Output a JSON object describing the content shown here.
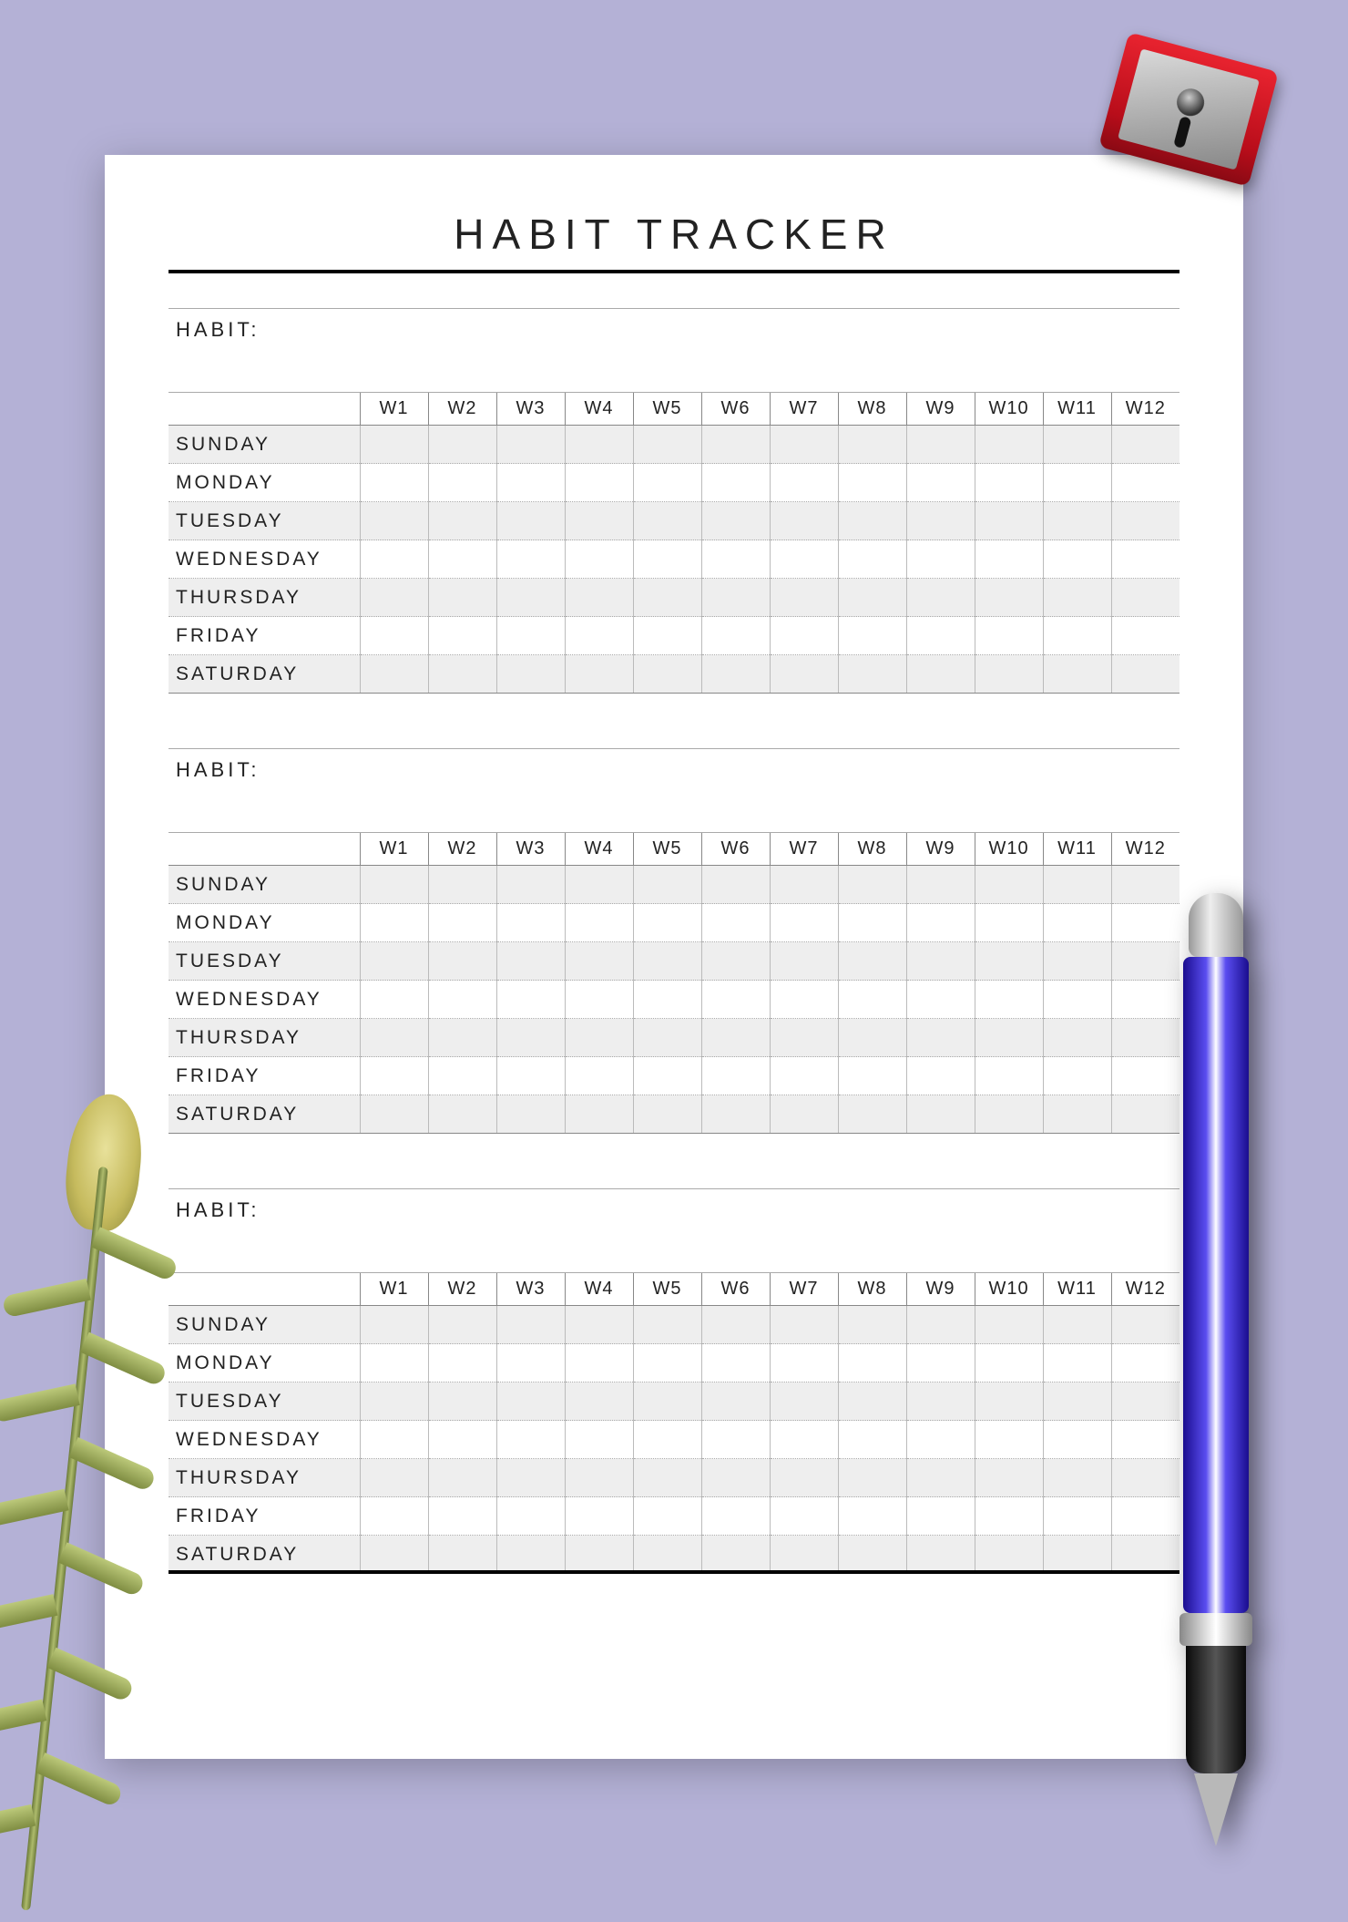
{
  "title": "HABIT TRACKER",
  "habit_label": "HABIT:",
  "weeks": [
    "W1",
    "W2",
    "W3",
    "W4",
    "W5",
    "W6",
    "W7",
    "W8",
    "W9",
    "W10",
    "W11",
    "W12"
  ],
  "days": [
    "SUNDAY",
    "MONDAY",
    "TUESDAY",
    "WEDNESDAY",
    "THURSDAY",
    "FRIDAY",
    "SATURDAY"
  ],
  "section_count": 3
}
